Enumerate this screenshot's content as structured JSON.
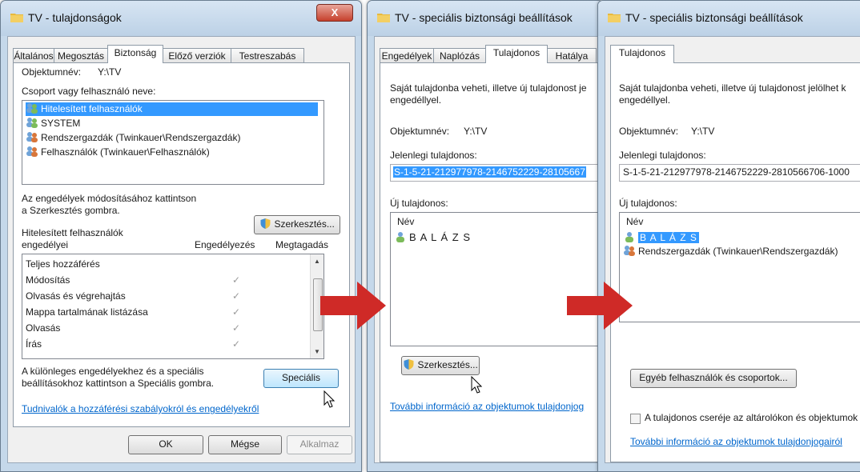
{
  "windows": {
    "properties": {
      "title": "TV - tulajdonságok",
      "close_label": "X",
      "tabs": [
        "Általános",
        "Megosztás",
        "Biztonság",
        "Előző verziók",
        "Testreszabás"
      ],
      "object_label": "Objektumnév:",
      "object_value": "Y:\\TV",
      "group_label": "Csoport vagy felhasználó neve:",
      "users": [
        "Hitelesített felhasználók",
        "SYSTEM",
        "Rendszergazdák (Twinkauer\\Rendszergazdák)",
        "Felhasználók (Twinkauer\\Felhasználók)"
      ],
      "edit_hint_line1": "Az engedélyek módosításához kattintson",
      "edit_hint_line2": "a Szerkesztés gombra.",
      "edit_button": "Szerkesztés...",
      "perm_header_line1": "Hitelesített felhasználók",
      "perm_header_line2": "engedélyei",
      "allow_header": "Engedélyezés",
      "deny_header": "Megtagadás",
      "permissions": [
        {
          "name": "Teljes hozzáférés",
          "allow": ""
        },
        {
          "name": "Módosítás",
          "allow": "✓"
        },
        {
          "name": "Olvasás és végrehajtás",
          "allow": "✓"
        },
        {
          "name": "Mappa tartalmának listázása",
          "allow": "✓"
        },
        {
          "name": "Olvasás",
          "allow": "✓"
        },
        {
          "name": "Írás",
          "allow": "✓"
        }
      ],
      "special_hint_line1": "A különleges engedélyekhez és a speciális",
      "special_hint_line2": "beállításokhoz kattintson a Speciális gombra.",
      "special_button": "Speciális",
      "help_link": "Tudnivalók a hozzáférési szabályokról és engedélyekről",
      "ok_button": "OK",
      "cancel_button": "Mégse",
      "apply_button": "Alkalmaz"
    },
    "advanced1": {
      "title": "TV - speciális biztonsági beállítások",
      "tabs": [
        "Engedélyek",
        "Naplózás",
        "Tulajdonos",
        "Hatálya"
      ],
      "desc_line1": "Saját tulajdonba veheti, illetve új tulajdonost je",
      "desc_line2": "engedéllyel.",
      "object_label": "Objektumnév:",
      "object_value": "Y:\\TV",
      "current_owner_label": "Jelenlegi tulajdonos:",
      "current_owner_value": "S-1-5-21-212977978-2146752229-28105667",
      "new_owner_label": "Új tulajdonos:",
      "name_header": "Név",
      "owners": [
        "B A L Á Z S"
      ],
      "edit_button": "Szerkesztés...",
      "more_link": "További információ az objektumok tulajdonjog"
    },
    "advanced2": {
      "title": "TV - speciális biztonsági beállítások",
      "tabs": [
        "Tulajdonos"
      ],
      "desc_line1": "Saját tulajdonba veheti, illetve új tulajdonost jelölhet k",
      "desc_line2": "engedéllyel.",
      "object_label": "Objektumnév:",
      "object_value": "Y:\\TV",
      "current_owner_label": "Jelenlegi tulajdonos:",
      "current_owner_value": "S-1-5-21-212977978-2146752229-2810566706-1000",
      "new_owner_label": "Új tulajdonos:",
      "name_header": "Név",
      "owners": [
        "B A L Á Z S",
        "Rendszergazdák (Twinkauer\\Rendszergazdák)"
      ],
      "others_button": "Egyéb felhasználók és csoportok...",
      "replace_checkbox": "A tulajdonos cseréje az altárolókon és objektumok",
      "more_link": "További információ az objektumok tulajdonjogairól"
    }
  },
  "colors": {
    "arrow": "#cf2a27",
    "selection": "#3399ff",
    "link": "#0066cc"
  }
}
